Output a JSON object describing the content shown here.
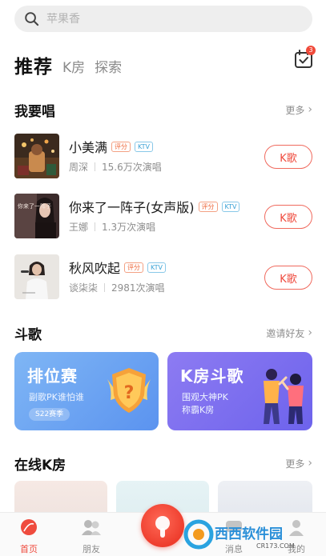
{
  "search": {
    "placeholder": "苹果香"
  },
  "tabs": {
    "active": "推荐",
    "items": [
      "K房",
      "探索"
    ]
  },
  "checkin": {
    "badge": "3"
  },
  "sing": {
    "title": "我要唱",
    "more": "更多",
    "songs": [
      {
        "name": "小美满",
        "tag_score": "评分",
        "tag_ktv": "KTV",
        "singer": "周深",
        "plays": "15.6万次演唱",
        "button": "K歌"
      },
      {
        "name": "你来了一阵子(女声版)",
        "tag_score": "评分",
        "tag_ktv": "KTV",
        "singer": "王娜",
        "plays": "1.3万次演唱",
        "button": "K歌",
        "cover_text": "你来了一阵子"
      },
      {
        "name": "秋风吹起",
        "tag_score": "评分",
        "tag_ktv": "KTV",
        "singer": "谈柒柒",
        "plays": "2981次演唱",
        "button": "K歌"
      }
    ]
  },
  "battle": {
    "title": "斗歌",
    "more": "邀请好友",
    "cards": [
      {
        "title": "排位赛",
        "subtitle": "副歌PK谁怕谁",
        "season": "S22赛季"
      },
      {
        "title": "K房斗歌",
        "subtitle_1": "围观大神PK",
        "subtitle_2": "称霸K房"
      }
    ]
  },
  "online": {
    "title": "在线K房",
    "more": "更多"
  },
  "nav": {
    "home": "首页",
    "friends": "朋友",
    "messages": "消息",
    "me": "我的"
  },
  "watermark": {
    "text": "西西软件园",
    "url": "CR173.COM"
  },
  "colors": {
    "accent": "#ef4b3e",
    "card_blue": "#5b93ef",
    "card_purple": "#6d63ec"
  }
}
